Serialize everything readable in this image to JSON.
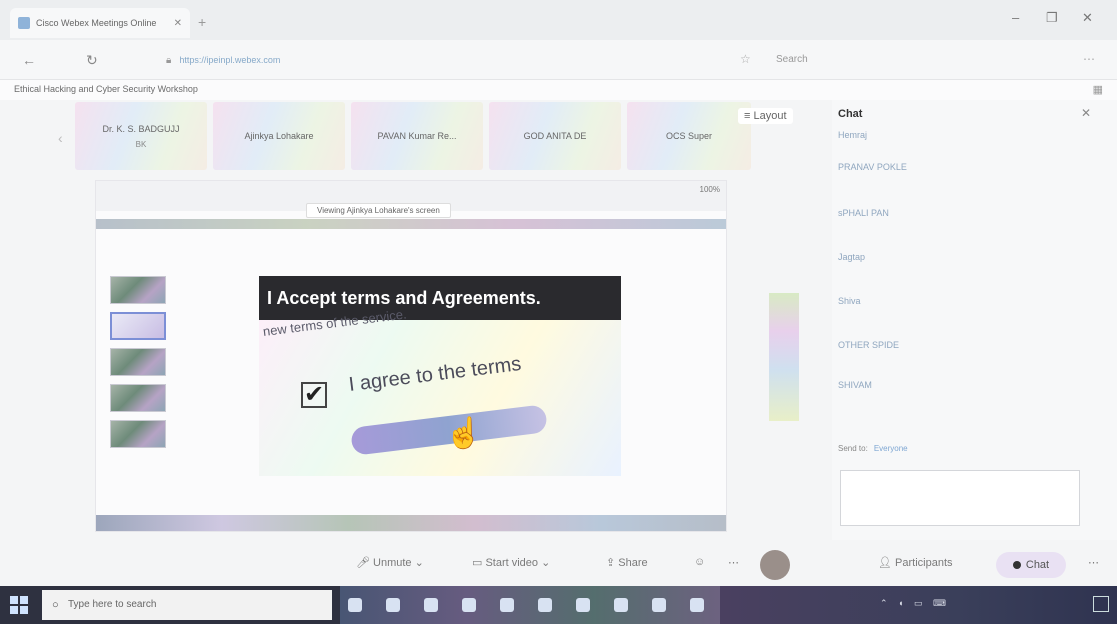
{
  "browser": {
    "tab_title": "Cisco Webex Meetings Online",
    "url": "https://ipeinpl.webex.com",
    "search_placeholder": "Search"
  },
  "meeting": {
    "title": "Ethical Hacking and Cyber Security Workshop",
    "layout_label": "Layout"
  },
  "participants": [
    {
      "name": "Dr. K. S. BADGUJJ",
      "sub": "BK"
    },
    {
      "name": "Ajinkya Lohakare",
      "sub": ""
    },
    {
      "name": "PAVAN Kumar Re...",
      "sub": ""
    },
    {
      "name": "GOD ANITA DE",
      "sub": ""
    },
    {
      "name": "OCS Super",
      "sub": ""
    }
  ],
  "share": {
    "sharing_label": "Viewing Ajinkya Lohakare's screen",
    "zoom": "100%",
    "slide_title": "I Accept terms and Agreements.",
    "slide_line": "new terms of the service.",
    "slide_agree": "I agree to the terms"
  },
  "controls": {
    "unmute": "Unmute",
    "start_video": "Start video",
    "share": "Share",
    "participants": "Participants",
    "chat": "Chat"
  },
  "chat": {
    "title": "Chat",
    "messages": [
      {
        "meta": "",
        "text": "Hemraj"
      },
      {
        "meta": "",
        "text": "PRANAV POKLE"
      },
      {
        "meta": "",
        "text": "sPHALI PAN"
      },
      {
        "meta": "",
        "text": "Jagtap"
      },
      {
        "meta": "",
        "text": "Shiva"
      },
      {
        "meta": "",
        "text": "OTHER SPIDE"
      },
      {
        "meta": "",
        "text": "SHIVAM"
      }
    ],
    "send_to_label": "Send to:",
    "send_to_value": "Everyone"
  },
  "taskbar": {
    "search_placeholder": "Type here to search"
  }
}
